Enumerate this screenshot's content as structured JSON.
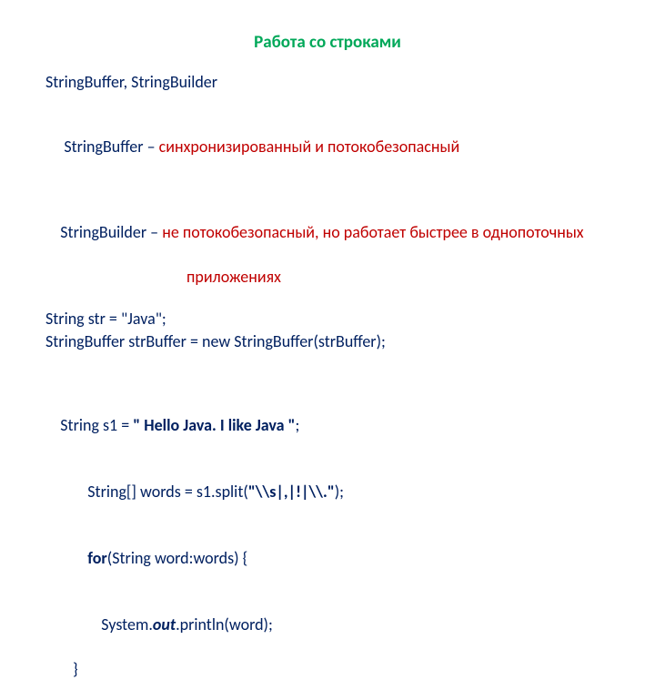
{
  "title": "Работа со строками",
  "l1": "StringBuffer, StringBuilder",
  "l2a": " StringBuffer – ",
  "l2b": "синхронизированный и потокобезопасный",
  "l3a": "StringBuilder – ",
  "l3b": "не потокобезопасный, но работает быстрее в однопоточных",
  "l3c": "приложениях",
  "l4": "String str = \"Java\";",
  "l5": "StringBuffer strBuffer = new StringBuffer(strBuffer);",
  "l6a": "String s1 = ",
  "l6b": "\" Hello Java. I like Java \"",
  "l6c": ";",
  "l7a": "String[] words = s1.split(",
  "l7b": "\"",
  "l7c": "\\\\s|,|!|\\\\.",
  "l7d": "\"",
  "l7e": ");",
  "l8a": "for",
  "l8b": "(String word:words) {",
  "l9a": "System.",
  "l9b": "out",
  "l9c": ".println(word);",
  "l10": "}"
}
